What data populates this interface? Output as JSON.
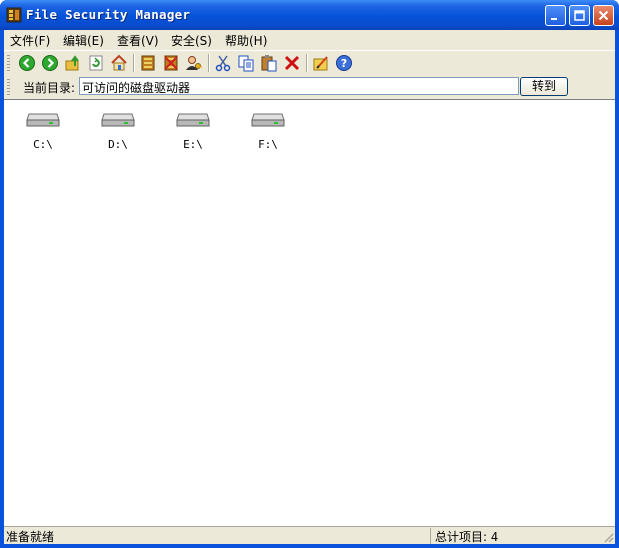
{
  "window": {
    "title": "File Security Manager"
  },
  "menu": [
    {
      "label": "文件(F)"
    },
    {
      "label": "编辑(E)"
    },
    {
      "label": "查看(V)"
    },
    {
      "label": "安全(S)"
    },
    {
      "label": "帮助(H)"
    }
  ],
  "toolbar": {
    "icons": [
      "back-icon",
      "forward-icon",
      "up-folder-icon",
      "refresh-icon",
      "home-icon",
      "encrypt-icon",
      "decrypt-icon",
      "user-key-icon",
      "cut-icon",
      "copy-icon",
      "paste-icon",
      "delete-icon",
      "properties-icon",
      "help-icon"
    ]
  },
  "address": {
    "label": "当前目录:",
    "value": "可访问的磁盘驱动器",
    "go_label": "转到"
  },
  "drives": [
    {
      "label": "C:\\"
    },
    {
      "label": "D:\\"
    },
    {
      "label": "E:\\"
    },
    {
      "label": "F:\\"
    }
  ],
  "status": {
    "left": "准备就绪",
    "count_label": "总计项目:",
    "count": "4"
  },
  "colors": {
    "title_bar": "#0a52dc",
    "close_button": "#c8431e",
    "face": "#ece9d8"
  }
}
